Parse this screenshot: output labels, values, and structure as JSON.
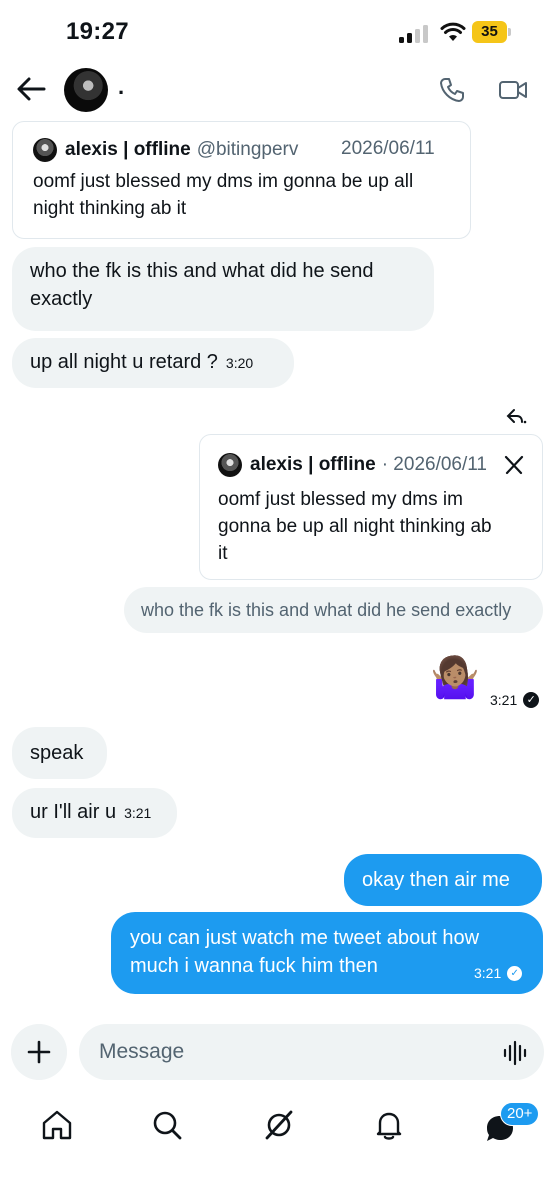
{
  "status_bar": {
    "time": "19:27",
    "battery": "35"
  },
  "header": {
    "name": "."
  },
  "thread": {
    "quote_1": {
      "name": "alexis | offline",
      "handle": "@bitingperv",
      "date": "2026/06/11",
      "text_line1": "oomf just blessed my dms im gonna be up all",
      "text_line2": "night thinking ab it"
    },
    "msg_1": {
      "line1": "who the fk is this and what did he send",
      "line2": "exactly"
    },
    "msg_2": {
      "text": "up all night u retard ?",
      "time": "3:20"
    },
    "quote_2": {
      "name": "alexis | offline",
      "date": "· 2026/06/11",
      "text_line1": "oomf just blessed my dms im",
      "text_line2": "gonna be up all night thinking ab",
      "text_line3": "it"
    },
    "sent_quoted": {
      "text": "who the fk is this and what did he send exactly"
    },
    "sent_emoji": {
      "emoji": "🤷🏽‍♀️",
      "time": "3:21"
    },
    "msg_3": {
      "text": "speak"
    },
    "msg_4": {
      "text": "ur I'll air u",
      "time": "3:21"
    },
    "sent_1": {
      "text": "okay then air me"
    },
    "sent_2": {
      "line1": "you can just watch me tweet about how",
      "line2": "much i wanna fuck him then",
      "time": "3:21"
    }
  },
  "composer": {
    "placeholder": "Message"
  },
  "nav": {
    "badge": "20+"
  },
  "colors": {
    "accent": "#1d9bf0",
    "bubble_gray": "#eff3f4",
    "text_secondary": "#536471"
  }
}
